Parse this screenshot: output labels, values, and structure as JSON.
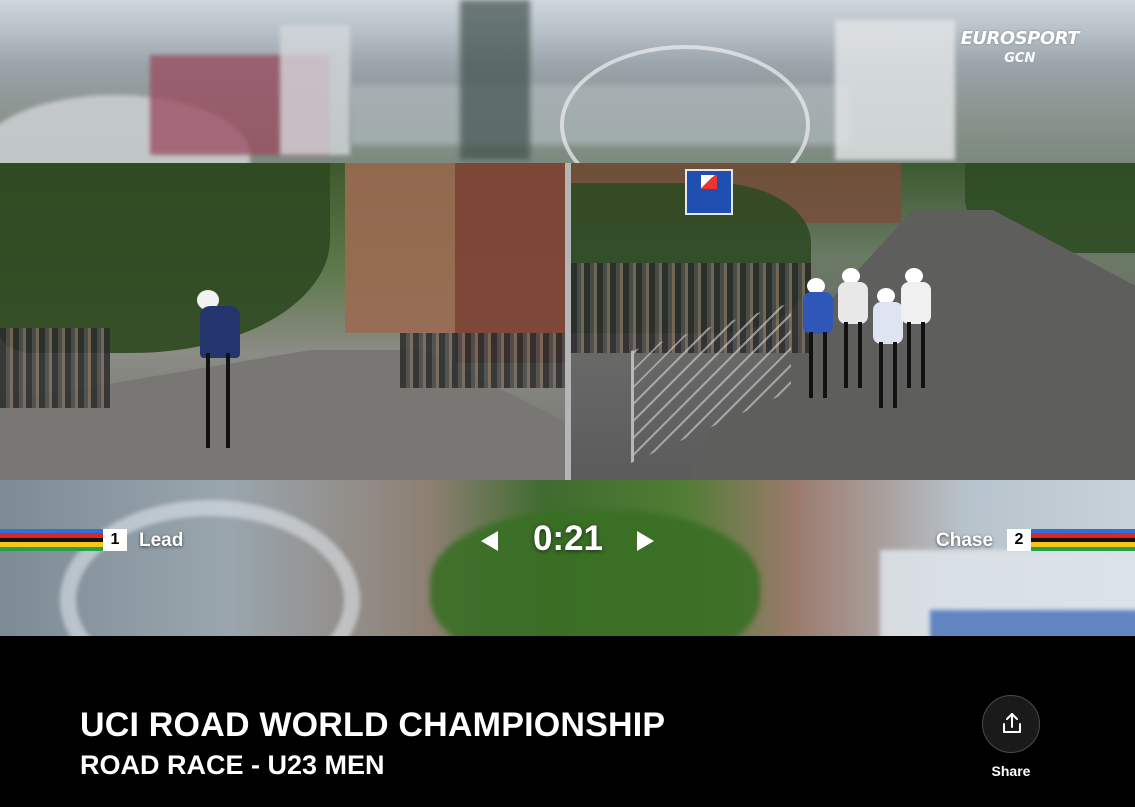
{
  "player": {
    "brand": {
      "line1": "EUROSPORT",
      "line2": "GCN"
    },
    "cameras": [
      {
        "number": "1",
        "label": "Lead"
      },
      {
        "number": "2",
        "label": "Chase"
      }
    ],
    "timer": "0:21",
    "roadside_sign": "Unsuitable for HGVs",
    "stripe_colors": [
      "#2f6fd6",
      "#d9262b",
      "#111111",
      "#f3c81a",
      "#27a04a"
    ]
  },
  "info": {
    "title": "UCI ROAD WORLD CHAMPIONSHIP",
    "subtitle": "ROAD RACE - U23 MEN",
    "share_label": "Share",
    "share_icon": "share-upload-icon"
  }
}
